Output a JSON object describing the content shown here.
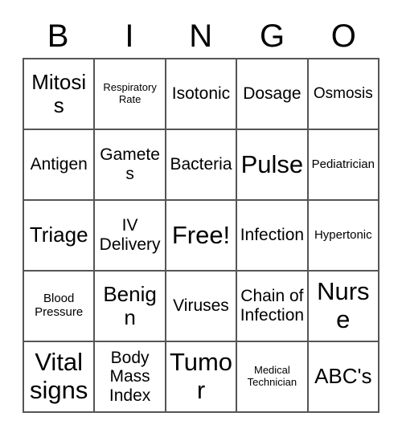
{
  "header": {
    "letters": [
      "B",
      "I",
      "N",
      "G",
      "O"
    ]
  },
  "grid": {
    "columns": 5,
    "rows": 5,
    "cells": [
      {
        "text": "Mitosis",
        "size": "lg"
      },
      {
        "text": "Respiratory Rate",
        "size": "xxs"
      },
      {
        "text": "Isotonic",
        "size": "md"
      },
      {
        "text": "Dosage",
        "size": "md"
      },
      {
        "text": "Osmosis",
        "size": "sm"
      },
      {
        "text": "Antigen",
        "size": "md"
      },
      {
        "text": "Gametes",
        "size": "md"
      },
      {
        "text": "Bacteria",
        "size": "md"
      },
      {
        "text": "Pulse",
        "size": "xl"
      },
      {
        "text": "Pediatrician",
        "size": "xs"
      },
      {
        "text": "Triage",
        "size": "lg"
      },
      {
        "text": "IV Delivery",
        "size": "md"
      },
      {
        "text": "Free!",
        "size": "xl"
      },
      {
        "text": "Infection",
        "size": "md"
      },
      {
        "text": "Hypertonic",
        "size": "xs"
      },
      {
        "text": "Blood Pressure",
        "size": "xs"
      },
      {
        "text": "Benign",
        "size": "lg"
      },
      {
        "text": "Viruses",
        "size": "md"
      },
      {
        "text": "Chain of Infection",
        "size": "md"
      },
      {
        "text": "Nurse",
        "size": "xl"
      },
      {
        "text": "Vital signs",
        "size": "xl"
      },
      {
        "text": "Body Mass Index",
        "size": "md"
      },
      {
        "text": "Tumor",
        "size": "xl"
      },
      {
        "text": "Medical Technician",
        "size": "xxs"
      },
      {
        "text": "ABC's",
        "size": "lg"
      }
    ]
  },
  "colors": {
    "background": "#ffffff",
    "text": "#000000",
    "border": "#555555"
  }
}
